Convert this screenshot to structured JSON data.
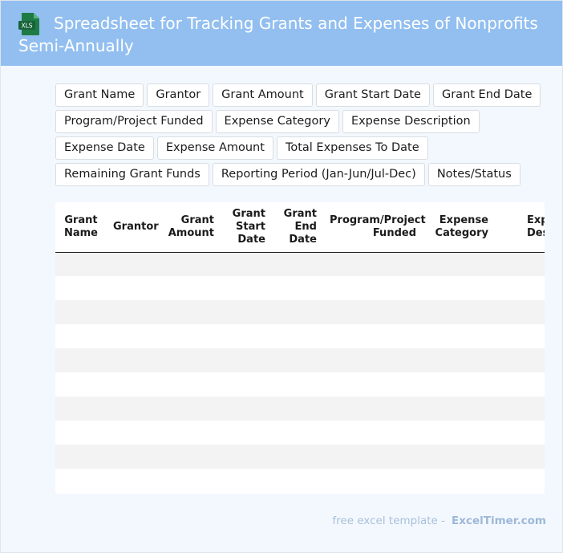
{
  "header": {
    "title": "Spreadsheet for Tracking Grants and Expenses of Nonprofits Semi-Annually",
    "icon_label": "XLS",
    "icon_color": "#1f7b45"
  },
  "chips": [
    "Grant Name",
    "Grantor",
    "Grant Amount",
    "Grant Start Date",
    "Grant End Date",
    "Program/Project Funded",
    "Expense Category",
    "Expense Description",
    "Expense Date",
    "Expense Amount",
    "Total Expenses To Date",
    "Remaining Grant Funds",
    "Reporting Period (Jan-Jun/Jul-Dec)",
    "Notes/Status"
  ],
  "table": {
    "headers": [
      "Grant Name",
      "Grantor",
      "Grant Amount",
      "Grant Start Date",
      "Grant End Date",
      "Program/Project Funded",
      "Expense Category",
      "Expense Description"
    ]
  },
  "footer": {
    "text": "free excel template -",
    "brand": "ExcelTimer.com"
  },
  "colors": {
    "header_bg": "#92bff0",
    "page_bg": "#f3f8fe",
    "row_stripe": "#f3f3f3"
  }
}
